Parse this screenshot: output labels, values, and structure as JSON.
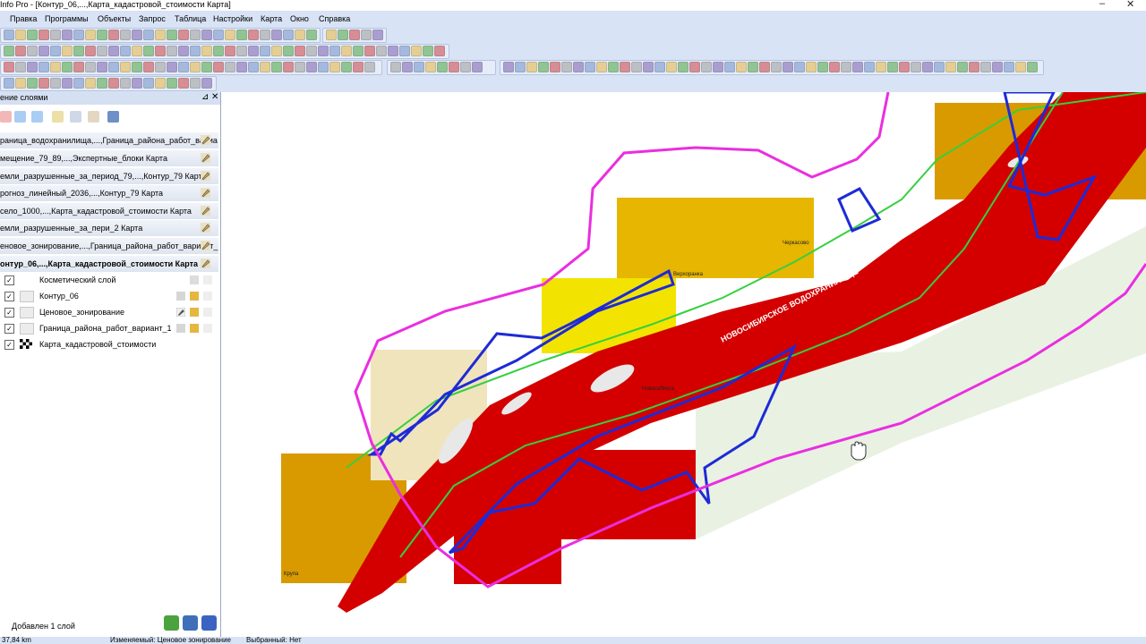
{
  "window": {
    "title": "Info Pro - [Контур_06,...,Карта_кадастровой_стоимости Карта]",
    "minimize_glyph": "–",
    "close_glyph": "✕"
  },
  "menu": [
    "Правка",
    "Программы",
    "Объекты",
    "Запрос",
    "Таблица",
    "Настройки",
    "Карта",
    "Окно",
    "Справка"
  ],
  "panel": {
    "title": "ение слоями",
    "pin_glyph": "⊿",
    "close_glyph": "✕",
    "groups": [
      "раница_водохранилища,...,Граница_района_работ_вариа",
      "мещение_79_89,...,Экспертные_блоки Карта",
      "емли_разрушенные_за_период_79,...,Контур_79 Карта",
      "рогноз_линейный_2036,...,Контур_79 Карта",
      "село_1000,...,Карта_кадастровой_стоимости Карта",
      "емли_разрушенные_за_пери_2 Карта",
      "еновое_зонирование,...,Граница_района_работ_вариант_",
      "онтур_06,...,Карта_кадастровой_стоимости Карта"
    ],
    "layers": [
      {
        "name": "Косметический слой",
        "checked": true
      },
      {
        "name": "Контур_06",
        "checked": true
      },
      {
        "name": "Ценовое_зонирование",
        "checked": true
      },
      {
        "name": "Граница_района_работ_вариант_1",
        "checked": true
      },
      {
        "name": "Карта_кадастровой_стоимости",
        "checked": true
      }
    ],
    "check_glyph": "✓",
    "status_message": "Добавлен 1 слой"
  },
  "statusbar": {
    "scale": "37,84 km",
    "edited": "Изменяемый: Ценовое зонирование",
    "selected": "Выбранный: Нет"
  },
  "map": {
    "reservoir_label": "НОВОСИБИРСКОЕ ВОДОХРАНИЛИЩЕ",
    "place_labels": [
      "Черкасово",
      "Верхоранка",
      "Крупа",
      "Новосибирск"
    ],
    "colors": {
      "water": "#d40000",
      "zone_yellow": "#f2e400",
      "zone_orange": "#d99a00",
      "zone_light": "#f0e4bc",
      "contour_blue": "#1d2bd6",
      "boundary_magenta": "#ea2ee0",
      "shore_green": "#36cf3e",
      "forest_green": "#e9f1e2"
    }
  }
}
